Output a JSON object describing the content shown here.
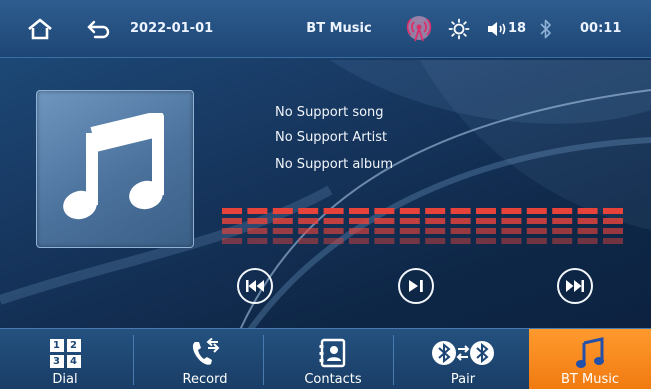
{
  "status_bar": {
    "date": "2022-01-01",
    "title": "BT Music",
    "volume": "18",
    "time": "00:11",
    "icons": [
      "home-icon",
      "back-icon",
      "radio-antenna-icon",
      "brightness-icon",
      "volume-icon",
      "bluetooth-icon"
    ]
  },
  "track": {
    "song": "No Support song",
    "artist": "No Support Artist",
    "album": "No Support album"
  },
  "playback": {
    "buttons": [
      "previous-track",
      "play-pause",
      "next-track"
    ]
  },
  "nav": {
    "dial_keys": [
      "1",
      "2",
      "3",
      "4"
    ],
    "tabs": [
      {
        "label": "Dial",
        "icon": "dialpad-icon"
      },
      {
        "label": "Record",
        "icon": "call-record-icon"
      },
      {
        "label": "Contacts",
        "icon": "contacts-icon"
      },
      {
        "label": "Pair",
        "icon": "bluetooth-pair-icon"
      },
      {
        "label": "BT Music",
        "icon": "music-note-icon",
        "active": true
      }
    ]
  },
  "colors": {
    "accent": "#f07a10",
    "equalizer": "#e8433a",
    "background": "#15335a"
  }
}
